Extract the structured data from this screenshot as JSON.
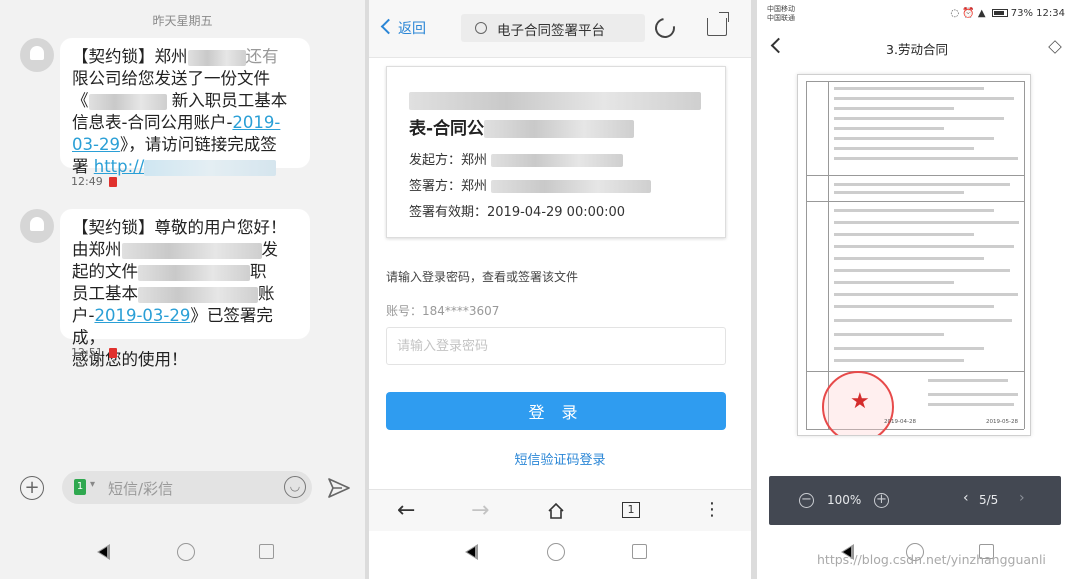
{
  "sms": {
    "date_header": "昨天星期五",
    "messages": [
      {
        "line1_pre": "【契约锁】郑州",
        "line1_post": "还有",
        "line2": "限公司给您发送了一份文件",
        "line3_pre": "《",
        "line3_post": " 新入职员工基本",
        "line4_pre": "信息表-合同公用账户-",
        "line4_link": "2019-",
        "line5_link": "03-29",
        "line5_post": "》，请访问链接完成签",
        "line6": "署",
        "link_text": "http://",
        "time": "12:49"
      },
      {
        "line1": "【契约锁】尊敬的用户您好！",
        "line2_pre": "由郑州",
        "line2_post": "发",
        "line3_pre": "起的文件",
        "line3_post": "职",
        "line4_pre": "员工基本",
        "line4_post": "账",
        "line5_pre": "户-",
        "line5_link": "2019-03-29",
        "line5_post": "》已签署完成，",
        "line6": "感谢您的使用！",
        "time": "12:51"
      }
    ],
    "compose_placeholder": "短信/彩信"
  },
  "browser": {
    "back_label": "返回",
    "url_title": "电子合同签署平台",
    "card": {
      "title_line2_pre": "表-合同公",
      "initiator_label": "发起方：郑州",
      "signer_label": "签署方：郑州",
      "validity": "签署有效期：2019-04-29 00:00:00"
    },
    "login_tip": "请输入登录密码，查看或签署该文件",
    "account": "账号：184****3607",
    "password_placeholder": "请输入登录密码",
    "login_button": "登 录",
    "sms_login": "短信验证码登录"
  },
  "viewer": {
    "carrier_1": "中国移动",
    "carrier_2": "中国联通",
    "battery": "73%",
    "clock": "12:34",
    "title": "3.劳动合同",
    "zoom": "100%",
    "page": "5/5",
    "page_dates": [
      "2019-04-28",
      "2019-05-28"
    ],
    "watermark": "https://blog.csdn.net/yinzhangguanli"
  },
  "colors": {
    "link": "#2a9fd6",
    "primary_button": "#2f9cf0",
    "seal": "#e74a4a",
    "zoom_bar": "#434852"
  }
}
